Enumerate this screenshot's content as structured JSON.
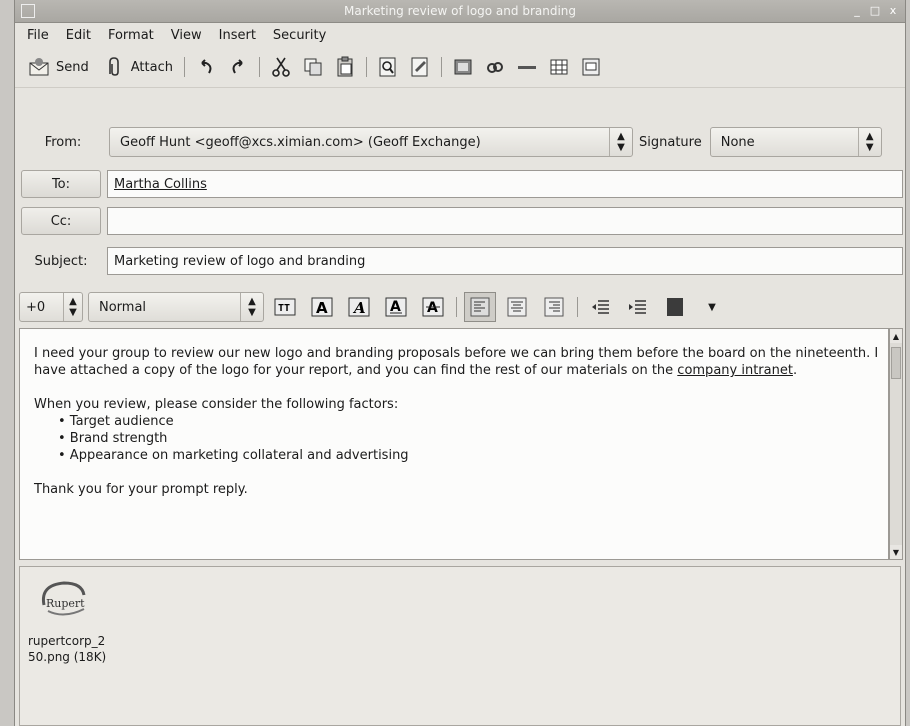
{
  "window": {
    "title": "Marketing review of logo and branding",
    "controls": [
      "_",
      "□",
      "x"
    ]
  },
  "menu": [
    "File",
    "Edit",
    "Format",
    "View",
    "Insert",
    "Security"
  ],
  "toolbar": {
    "send_label": "Send",
    "attach_label": "Attach"
  },
  "header": {
    "from_label": "From:",
    "from_value": "Geoff Hunt <geoff@xcs.ximian.com> (Geoff Exchange)",
    "signature_label": "Signature",
    "signature_value": "None",
    "to_button": "To:",
    "to_value": "Martha Collins",
    "cc_button": "Cc:",
    "cc_value": "",
    "subject_label": "Subject:",
    "subject_value": "Marketing review of logo and branding"
  },
  "format": {
    "size": "+0",
    "style": "Normal"
  },
  "body": {
    "para1_pre": "I need your group to review our new logo and branding proposals before we can bring them before the board on the nineteenth.  I have attached a copy of the logo for your report, and you can find the rest of our materials on the ",
    "link": "company intranet",
    "para1_post": ".",
    "para2": "When you review, please consider the following factors:",
    "bullets": [
      "• Target audience",
      "• Brand strength",
      "• Appearance on marketing collateral and advertising"
    ],
    "closing": "Thank you for your prompt reply."
  },
  "attachment": {
    "logo_text": "Rupert",
    "name_line1": "rupertcorp_2",
    "name_line2": "50.png (18K)"
  }
}
